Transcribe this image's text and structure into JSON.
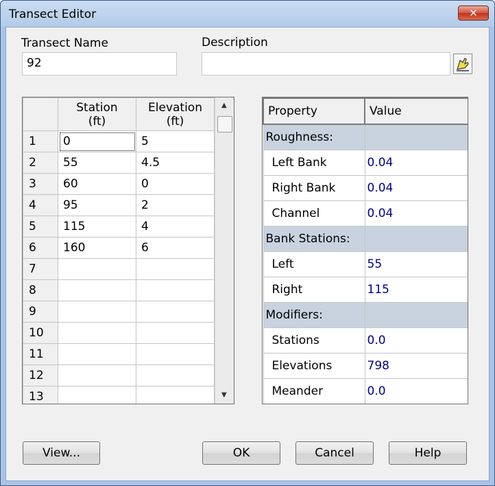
{
  "window": {
    "title": "Transect Editor",
    "close_symbol": "✕"
  },
  "transect_name": {
    "label": "Transect Name",
    "value": "92"
  },
  "description": {
    "label": "Description",
    "value": ""
  },
  "grid": {
    "headers": [
      {
        "line1": "Station",
        "line2": "(ft)"
      },
      {
        "line1": "Elevation",
        "line2": "(ft)"
      }
    ],
    "rows": [
      {
        "n": "1",
        "station": "0",
        "elevation": "5"
      },
      {
        "n": "2",
        "station": "55",
        "elevation": "4.5"
      },
      {
        "n": "3",
        "station": "60",
        "elevation": "0"
      },
      {
        "n": "4",
        "station": "95",
        "elevation": "2"
      },
      {
        "n": "5",
        "station": "115",
        "elevation": "4"
      },
      {
        "n": "6",
        "station": "160",
        "elevation": "6"
      },
      {
        "n": "7",
        "station": "",
        "elevation": ""
      },
      {
        "n": "8",
        "station": "",
        "elevation": ""
      },
      {
        "n": "9",
        "station": "",
        "elevation": ""
      },
      {
        "n": "10",
        "station": "",
        "elevation": ""
      },
      {
        "n": "11",
        "station": "",
        "elevation": ""
      },
      {
        "n": "12",
        "station": "",
        "elevation": ""
      },
      {
        "n": "13",
        "station": "",
        "elevation": ""
      }
    ]
  },
  "properties": {
    "header_property": "Property",
    "header_value": "Value",
    "roughness": {
      "label": "Roughness:",
      "left_bank_label": "Left Bank",
      "left_bank": "0.04",
      "right_bank_label": "Right Bank",
      "right_bank": "0.04",
      "channel_label": "Channel",
      "channel": "0.04"
    },
    "bank_stations": {
      "label": "Bank Stations:",
      "left_label": "Left",
      "left": "55",
      "right_label": "Right",
      "right": "115"
    },
    "modifiers": {
      "label": "Modifiers:",
      "stations_label": "Stations",
      "stations": "0.0",
      "elevations_label": "Elevations",
      "elevations": "798",
      "meander_label": "Meander",
      "meander": "0.0"
    }
  },
  "buttons": {
    "view": "View...",
    "ok": "OK",
    "cancel": "Cancel",
    "help": "Help"
  },
  "colors": {
    "title_bar": "#b9cfea",
    "category_row": "#c8d3df",
    "value_text": "#00008b",
    "close_button": "#c8452d"
  }
}
